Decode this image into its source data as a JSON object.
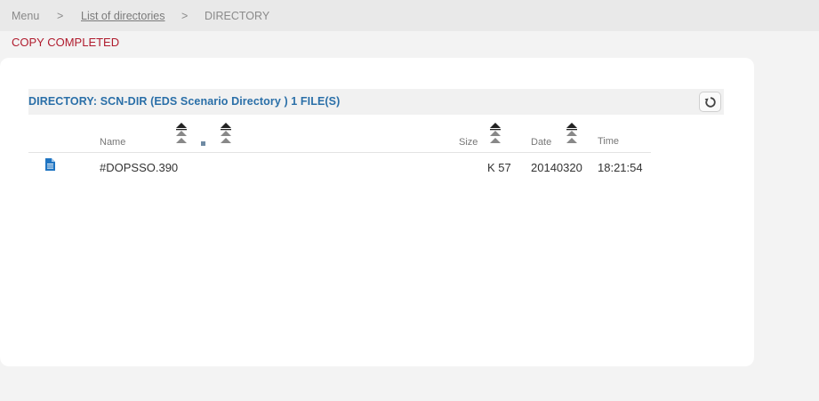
{
  "breadcrumb": {
    "menu": "Menu",
    "sep1": ">",
    "list_link": "List of directories",
    "sep2": ">",
    "current": "DIRECTORY"
  },
  "status_message": "COPY COMPLETED",
  "directory": {
    "title": "DIRECTORY: SCN-DIR (EDS Scenario Directory ) 1 FILE(S)",
    "refresh_icon": "refresh-icon"
  },
  "columns": {
    "name": "Name",
    "size": "Size",
    "date": "Date",
    "time": "Time"
  },
  "files": [
    {
      "icon": "file-icon",
      "name": "#DOPSSO.390",
      "size": "K 57",
      "date": "20140320",
      "time": "18:21:54"
    }
  ],
  "colors": {
    "accent": "#2a6fa8",
    "status": "#b01c2e",
    "file_icon": "#1f74c2"
  }
}
